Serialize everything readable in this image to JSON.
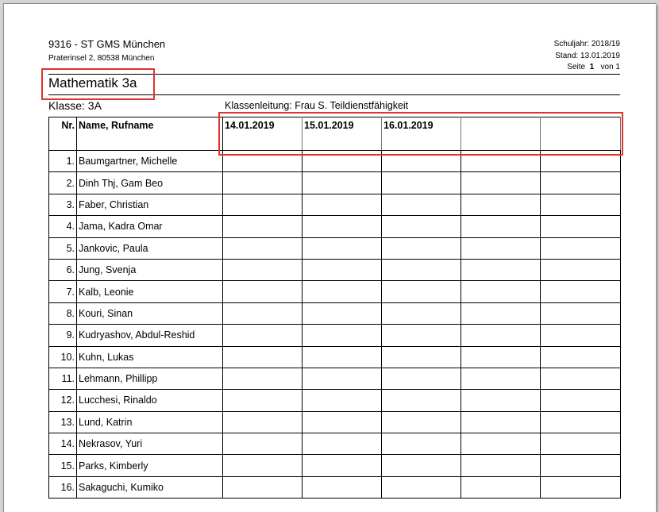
{
  "school": {
    "name": "9316 - ST GMS München",
    "address": "Praterinsel 2, 80538 München"
  },
  "meta": {
    "school_year": "Schuljahr: 2018/19",
    "as_of": "Stand: 13.01.2019",
    "page_label": "Seite",
    "page_number": "1",
    "of_label": "von 1"
  },
  "subject_title": "Mathematik 3a",
  "class_label": "Klasse: 3A",
  "teacher_label": "Klassenleitung: Frau S. Teildienstfähigkeit",
  "table": {
    "header_nr": "Nr.",
    "header_name": "Name, Rufname",
    "dates": [
      "14.01.2019",
      "15.01.2019",
      "16.01.2019",
      "",
      ""
    ],
    "students": [
      {
        "nr": "1.",
        "name": "Baumgartner, Michelle"
      },
      {
        "nr": "2.",
        "name": "Dinh Thj, Gam Beo"
      },
      {
        "nr": "3.",
        "name": "Faber, Christian"
      },
      {
        "nr": "4.",
        "name": "Jama, Kadra Omar"
      },
      {
        "nr": "5.",
        "name": "Jankovic, Paula"
      },
      {
        "nr": "6.",
        "name": "Jung, Svenja"
      },
      {
        "nr": "7.",
        "name": "Kalb, Leonie"
      },
      {
        "nr": "8.",
        "name": "Kouri, Sinan"
      },
      {
        "nr": "9.",
        "name": "Kudryashov, Abdul-Reshid"
      },
      {
        "nr": "10.",
        "name": "Kuhn, Lukas"
      },
      {
        "nr": "11.",
        "name": "Lehmann, Phillipp"
      },
      {
        "nr": "12.",
        "name": "Lucchesi, Rinaldo"
      },
      {
        "nr": "13.",
        "name": "Lund, Katrin"
      },
      {
        "nr": "14.",
        "name": "Nekrasov, Yuri"
      },
      {
        "nr": "15.",
        "name": "Parks, Kimberly"
      },
      {
        "nr": "16.",
        "name": "Sakaguchi, Kumiko"
      }
    ]
  },
  "highlight_color": "#e0342f"
}
